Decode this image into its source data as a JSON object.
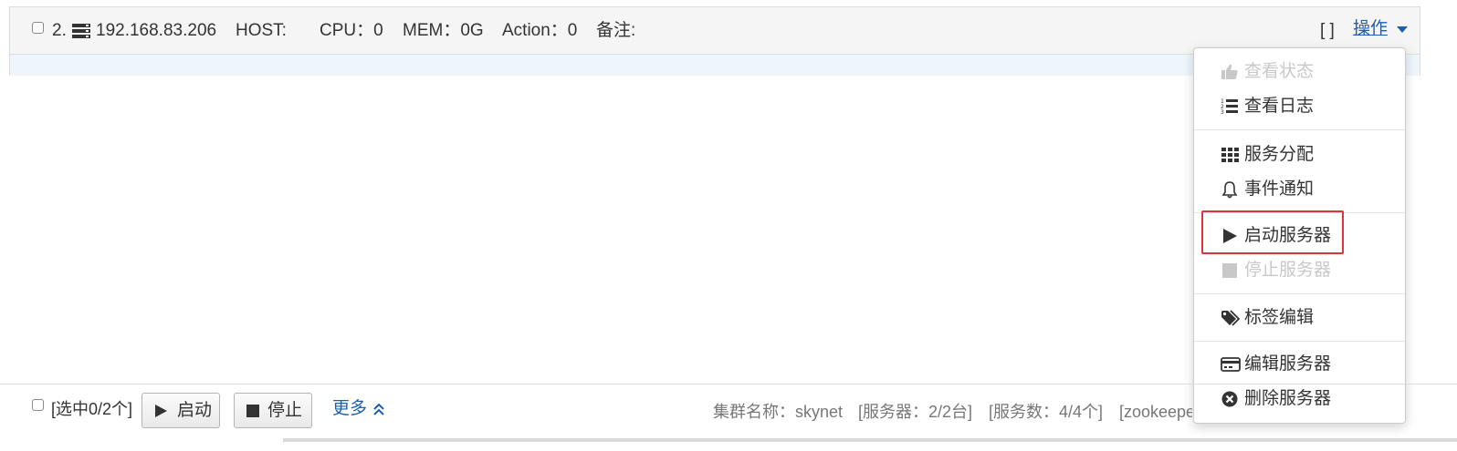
{
  "server_row": {
    "index": "2.",
    "ip": "192.168.83.206",
    "host_label": "HOST:",
    "cpu_label": "CPU：0",
    "mem_label": "MEM：0G",
    "action_label": "Action：0",
    "remark_label": "备注:",
    "tags_bracket": "[ ]",
    "ops_label": "操作"
  },
  "dropdown": {
    "items": [
      {
        "label": "查看状态",
        "icon": "thumbs-up-icon",
        "disabled": true
      },
      {
        "label": "查看日志",
        "icon": "ordered-list-icon",
        "disabled": false
      },
      {
        "label": "服务分配",
        "icon": "grid-icon",
        "disabled": false
      },
      {
        "label": "事件通知",
        "icon": "bell-icon",
        "disabled": false
      },
      {
        "label": "启动服务器",
        "icon": "play-icon",
        "disabled": false
      },
      {
        "label": "停止服务器",
        "icon": "stop-icon",
        "disabled": true
      },
      {
        "label": "标签编辑",
        "icon": "tags-icon",
        "disabled": false
      },
      {
        "label": "编辑服务器",
        "icon": "credit-card-icon",
        "disabled": false
      },
      {
        "label": "删除服务器",
        "icon": "remove-circle-icon",
        "disabled": false
      }
    ]
  },
  "footer": {
    "select_count": "[选中0/2个]",
    "start_label": "启动",
    "stop_label": "停止",
    "more_label": "更多",
    "cluster_name": "集群名称：skynet",
    "server_count": "[服务器：2/2台]",
    "service_count": "[服务数：4/4个]",
    "zookeeper": "[zookeepe"
  },
  "colors": {
    "link": "#1a5fb4",
    "highlight": "#e0323a",
    "disabled": "#c8c8c8"
  }
}
